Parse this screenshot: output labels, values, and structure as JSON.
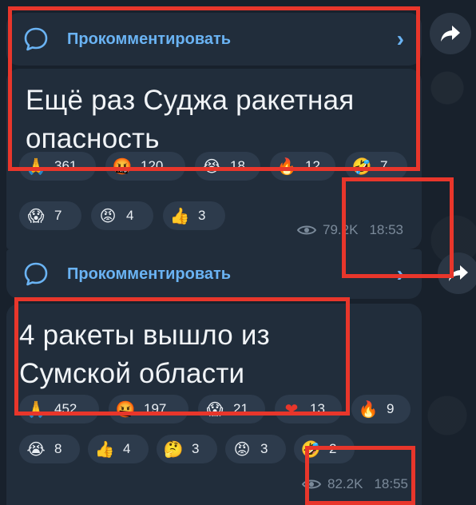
{
  "colors": {
    "accent": "#6ab3f3",
    "highlight": "#e8362b",
    "bubble": "#212d3b"
  },
  "posts": [
    {
      "comment_label": "Прокомментировать",
      "message": [
        "Ещё раз Суджа ракетная",
        "опасность"
      ],
      "reactions": [
        {
          "emoji": "🙏",
          "count": "361"
        },
        {
          "emoji": "🤬",
          "count": "120"
        },
        {
          "emoji": "😭",
          "count": "18"
        },
        {
          "emoji": "🔥",
          "count": "12"
        },
        {
          "emoji": "🤣",
          "count": "7"
        },
        {
          "emoji": "😱",
          "count": "7"
        },
        {
          "emoji": "😡",
          "count": "4"
        },
        {
          "emoji": "👍",
          "count": "3"
        }
      ],
      "views": "79.2K",
      "time": "18:53"
    },
    {
      "comment_label": "Прокомментировать",
      "message": [
        "4 ракеты вышло из",
        "Сумской области"
      ],
      "reactions": [
        {
          "emoji": "🙏",
          "count": "452"
        },
        {
          "emoji": "🤬",
          "count": "197"
        },
        {
          "emoji": "😱",
          "count": "21"
        },
        {
          "emoji": "❤",
          "count": "13"
        },
        {
          "emoji": "🔥",
          "count": "9"
        },
        {
          "emoji": "😭",
          "count": "8"
        },
        {
          "emoji": "👍",
          "count": "4"
        },
        {
          "emoji": "🤔",
          "count": "3"
        },
        {
          "emoji": "😡",
          "count": "3"
        },
        {
          "emoji": "🤣",
          "count": "2"
        }
      ],
      "views": "82.2K",
      "time": "18:55"
    }
  ],
  "icons": {
    "comment": "comment-bubble-icon",
    "chevron": "chevron-right-icon",
    "share": "share-arrow-icon",
    "views": "eye-icon"
  },
  "chevron_glyph": "›"
}
